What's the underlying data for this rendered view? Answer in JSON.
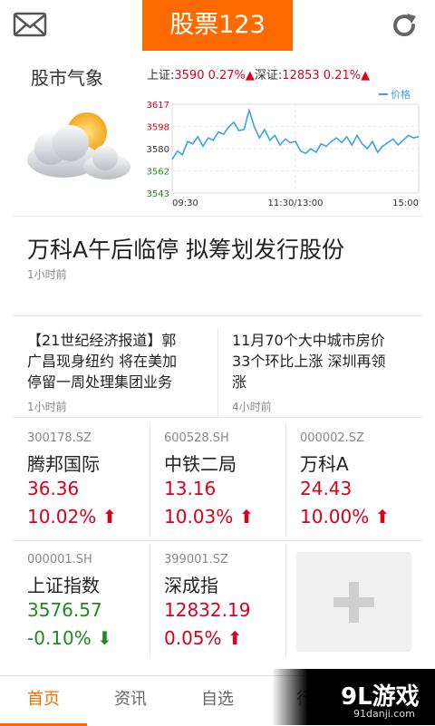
{
  "header": {
    "title": "股票123",
    "mail_icon": "mail-icon",
    "refresh_icon": "refresh-icon"
  },
  "market": {
    "label": "股市气象",
    "sh_label": "上证:",
    "sh_value": "3590 0.27%",
    "sz_label": "深证:",
    "sz_value": "12853 0.21%",
    "weather_icon": "partly-cloudy-icon"
  },
  "chart_data": {
    "type": "line",
    "legend": "价格",
    "legend_position": "top-right",
    "y_ticks": [
      "3617",
      "3598",
      "3580",
      "3562",
      "3543"
    ],
    "x_ticks": [
      "09:30",
      "11:30/13:00",
      "15:00"
    ],
    "ylim": [
      3543,
      3617
    ],
    "grid": true,
    "series": [
      {
        "name": "价格",
        "x": [
          0,
          5,
          10,
          15,
          20,
          25,
          30,
          35,
          40,
          45,
          50,
          55,
          60,
          65,
          70,
          75,
          80,
          85,
          90,
          95,
          100,
          105,
          110,
          115,
          120,
          125,
          130,
          135,
          140,
          145,
          150,
          155,
          160,
          165,
          170,
          175,
          180,
          185,
          190,
          195,
          200,
          205,
          210,
          215,
          220,
          225,
          230,
          235,
          240
        ],
        "values": [
          3571,
          3578,
          3575,
          3586,
          3584,
          3590,
          3582,
          3589,
          3587,
          3594,
          3592,
          3598,
          3602,
          3595,
          3596,
          3612,
          3598,
          3589,
          3596,
          3587,
          3591,
          3583,
          3588,
          3585,
          3586,
          3578,
          3576,
          3580,
          3577,
          3584,
          3582,
          3586,
          3589,
          3585,
          3590,
          3583,
          3591,
          3584,
          3580,
          3586,
          3577,
          3582,
          3585,
          3588,
          3583,
          3587,
          3591,
          3589,
          3590
        ]
      }
    ],
    "colors": {
      "line": "#3aa3e3",
      "axis_up": "#d9001b",
      "axis_mid": "#333333",
      "axis_down": "#1f8a1f"
    }
  },
  "headline": {
    "title": "万科A午后临停 拟筹划发行股份",
    "time": "1小时前"
  },
  "news": [
    {
      "lines": [
        "【21世纪经济报道】郭",
        "广昌现身纽约 将在美加",
        "停留一周处理集团业务"
      ],
      "time": "1小时前"
    },
    {
      "lines": [
        "11月70个大中城市房价",
        "33个环比上涨 深圳再领",
        "涨"
      ],
      "time": "4小时前"
    }
  ],
  "stocks": [
    {
      "code": "300178.SZ",
      "name": "腾邦国际",
      "price": "36.36",
      "change": "10.02%",
      "dir": "up"
    },
    {
      "code": "600528.SH",
      "name": "中铁二局",
      "price": "13.16",
      "change": "10.03%",
      "dir": "up"
    },
    {
      "code": "000002.SZ",
      "name": "万科A",
      "price": "24.43",
      "change": "10.00%",
      "dir": "up"
    },
    {
      "code": "000001.SH",
      "name": "上证指数",
      "price": "3576.57",
      "change": "-0.10%",
      "dir": "down"
    },
    {
      "code": "399001.SZ",
      "name": "深成指",
      "price": "12832.19",
      "change": "0.05%",
      "dir": "up"
    }
  ],
  "add_tile": {
    "icon": "plus-icon"
  },
  "nav": {
    "items": [
      "首页",
      "资讯",
      "自选",
      "行"
    ],
    "active_index": 0
  },
  "watermark": {
    "logo": "9L游戏",
    "url": "91danji.com"
  },
  "colors": {
    "accent": "#ff6a00",
    "up": "#d9001b",
    "down": "#1f8a1f",
    "chart_line": "#3aa3e3"
  }
}
